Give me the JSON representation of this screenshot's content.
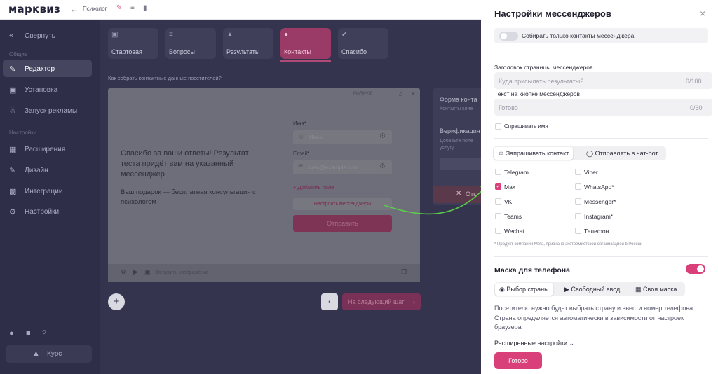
{
  "brand": {
    "logo": "марквиз",
    "accent": "#d9407a"
  },
  "topbar": {
    "quiz_name": "Психолог"
  },
  "sidebar": {
    "collapse": "Свернуть",
    "section_general": "Общие",
    "items": [
      {
        "label": "Редактор"
      },
      {
        "label": "Установка"
      },
      {
        "label": "Запуск рекламы"
      }
    ],
    "section_settings": "Настройки",
    "items2": [
      {
        "label": "Расширения"
      },
      {
        "label": "Дизайн"
      },
      {
        "label": "Интеграции"
      },
      {
        "label": "Настройки"
      }
    ],
    "course": "Курс"
  },
  "steps": [
    {
      "label": "Стартовая"
    },
    {
      "label": "Вопросы"
    },
    {
      "label": "Результаты"
    },
    {
      "label": "Контакты"
    },
    {
      "label": "Спасибо"
    }
  ],
  "main": {
    "help_link": "Как собрать контактные данные посетителей?",
    "preview_brand": "MARKVIZ",
    "preview_title": "Спасибо за ваши ответы! Результат теста придёт вам на указанный мессенджер",
    "preview_gift": "Ваш подарок — бесплатная консультация с психологом",
    "name_label": "Имя*",
    "name_ph": "Иван",
    "email_label": "Email*",
    "email_ph": "ivan@example.com",
    "add_field": "+ Добавить поле",
    "setup_messengers": "Настроить мессенджеры",
    "submit": "Отправить",
    "footer_text": "Загрузить изображение",
    "side_form": "Форма конта",
    "side_form_sub": "Контакты клие",
    "side_verify": "Верификация",
    "side_verify_sub1": "Добавьте поле",
    "side_verify_sub2": "услугу",
    "side_close": "Отк",
    "next_step": "На следующий шаг"
  },
  "modal": {
    "title": "Настройки мессенджеров",
    "collect_only": "Собирать только контакты мессенджера",
    "header_label": "Заголовок страницы мессенджеров",
    "header_ph": "Куда присылать результаты?",
    "header_count": "0/100",
    "button_label": "Текст на кнопке мессенджеров",
    "button_ph": "Готово",
    "button_count": "0/60",
    "ask_name": "Спрашивать имя",
    "tab_request": "Запрашивать контакт",
    "tab_bot": "Отправлять в чат-бот",
    "messengers_left": [
      {
        "label": "Telegram",
        "checked": false
      },
      {
        "label": "Max",
        "checked": true
      },
      {
        "label": "VK",
        "checked": false
      },
      {
        "label": "Teams",
        "checked": false
      },
      {
        "label": "Wechat",
        "checked": false
      }
    ],
    "messengers_right": [
      {
        "label": "Viber"
      },
      {
        "label": "WhatsApp*"
      },
      {
        "label": "Messenger*"
      },
      {
        "label": "Instagram*"
      },
      {
        "label": "Телефон"
      }
    ],
    "meta_note": "* Продукт компании Meta, признана экстремистской организацией в России",
    "mask_title": "Маска для телефона",
    "mask_on": true,
    "mask_tabs": [
      {
        "label": "Выбор страны"
      },
      {
        "label": "Свободный ввод"
      },
      {
        "label": "Своя маска"
      }
    ],
    "mask_desc": "Посетителю нужно будет выбрать страну и ввести номер телефона. Страна определяется автоматически в зависимости от настроек браузера",
    "advanced": "Расширенные настройки",
    "done": "Готово"
  }
}
